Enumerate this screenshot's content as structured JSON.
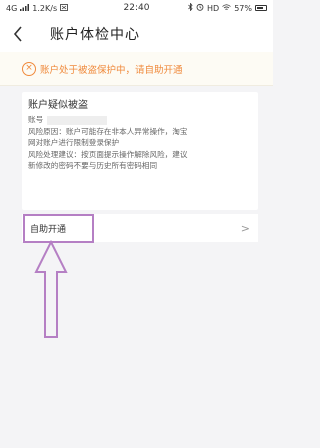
{
  "status_bar": {
    "network": "4G",
    "speed": "1.2K/s",
    "time": "22:40",
    "hd": "HD",
    "battery": "57%"
  },
  "nav": {
    "title": "账户体检中心"
  },
  "warning": {
    "text": "账户处于被盗保护中，请自助开通"
  },
  "risk_card": {
    "title": "账户疑似被盗",
    "account_label": "账号",
    "lines": [
      "风险原因：账户可能存在非本人异常操作，淘宝",
      "网对账户进行限制登录保护",
      "风险处理建议：按页面提示操作解除风险，建议",
      "新修改的密码不要与历史所有密码相同"
    ]
  },
  "action": {
    "label": "自助开通",
    "chevron": ">"
  },
  "colors": {
    "warning": "#f08a3c",
    "annotation": "#b57fc4"
  }
}
